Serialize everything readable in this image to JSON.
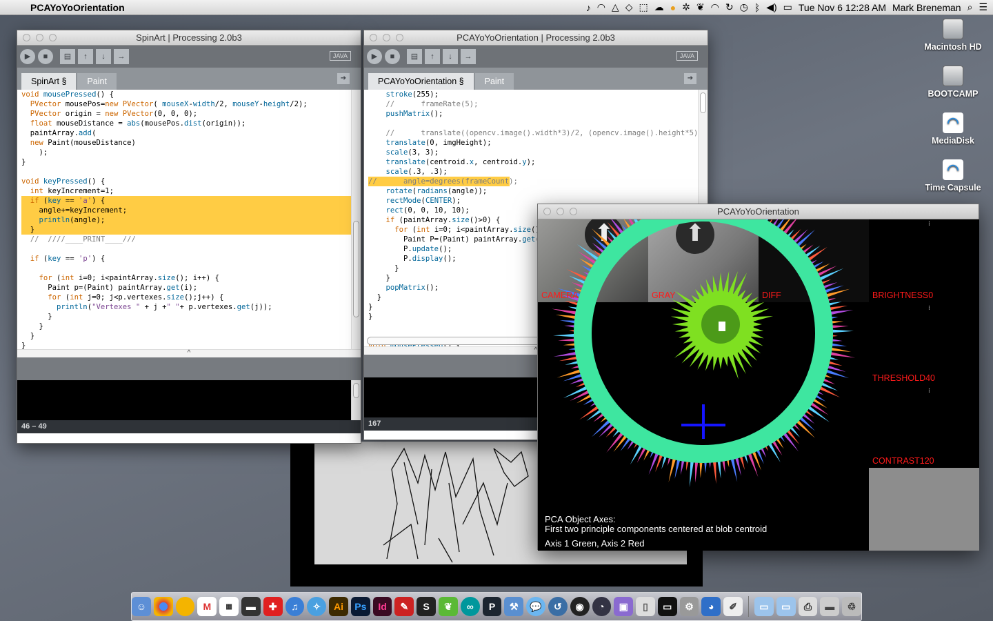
{
  "menubar": {
    "apple_icon": "apple-icon",
    "app_name": "PCAYoYoOrientation",
    "datetime": "Tue Nov 6  12:28 AM",
    "user": "Mark Breneman",
    "extra_icons": [
      "music-icon",
      "headphones-icon",
      "drive-icon",
      "dropbox-icon",
      "screenshot-icon",
      "cloud-icon",
      "moon-icon",
      "sync-icon",
      "evernote-icon",
      "wifi-icon",
      "refresh-icon",
      "time-machine-icon",
      "bluetooth-icon",
      "volume-icon",
      "battery-icon"
    ]
  },
  "desktop": {
    "icons": [
      {
        "label": "Macintosh HD",
        "icon": "hard-drive-icon"
      },
      {
        "label": "BOOTCAMP",
        "icon": "hard-drive-icon"
      },
      {
        "label": "MediaDisk",
        "icon": "network-disk-icon"
      },
      {
        "label": "Time Capsule",
        "icon": "network-disk-icon"
      }
    ]
  },
  "windows": {
    "spinart": {
      "title": "SpinArt | Processing 2.0b3",
      "java_badge": "JAVA",
      "tabs": [
        "SpinArt §",
        "Paint"
      ],
      "status_line": "46 – 49",
      "collapse_glyph": "^"
    },
    "pca_editor": {
      "title": "PCAYoYoOrientation | Processing 2.0b3",
      "java_badge": "JAVA",
      "tabs": [
        "PCAYoYoOrientation §",
        "Paint"
      ],
      "status_line": "167",
      "collapse_glyph": "^"
    },
    "sketch": {
      "title": "PCAYoYoOrientation",
      "labels": {
        "camera": "CAMERA",
        "gray": "GRAY",
        "diff": "DIFF",
        "brightness": "BRIGHTNESS0",
        "threshold": "THRESHOLD40",
        "contrast": "CONTRAST120"
      },
      "caption": {
        "line1": "PCA Object Axes:",
        "line2": "First two principle components centered at blob centroid",
        "line3": "Axis 1 Green, Axis 2 Red"
      }
    }
  },
  "colors": {
    "highlight": "#ffcc44",
    "ring": "#3ee6a0",
    "blob": "#7fe021",
    "axis2": "#1515ff",
    "label_red": "#ff1a1a"
  },
  "dock": {
    "apps": [
      "finder-icon",
      "chrome-icon",
      "firefox-icon",
      "gmail-icon",
      "calendar-icon",
      "system-prefs-icon",
      "swiss-icon",
      "itunes-icon",
      "safari-icon",
      "illustrator-icon",
      "photoshop-icon",
      "indesign-icon",
      "sketchbook-icon",
      "sublime-icon",
      "evernote-leaf-icon",
      "arduino-icon",
      "processing-icon",
      "xcode-icon",
      "messages-icon",
      "time-machine-icon",
      "dashboard-icon",
      "activity-icon",
      "preview-icon",
      "paper-icon",
      "terminal-icon",
      "circuit-icon",
      "cyberduck-icon",
      "script-icon",
      "folder-icon",
      "folder-icon",
      "printer-icon",
      "disk-icon",
      "trash-icon"
    ],
    "labels": {
      "illustrator": "Ai",
      "photoshop": "Ps",
      "indesign": "Id",
      "sublime": "S",
      "processing": "P"
    }
  }
}
